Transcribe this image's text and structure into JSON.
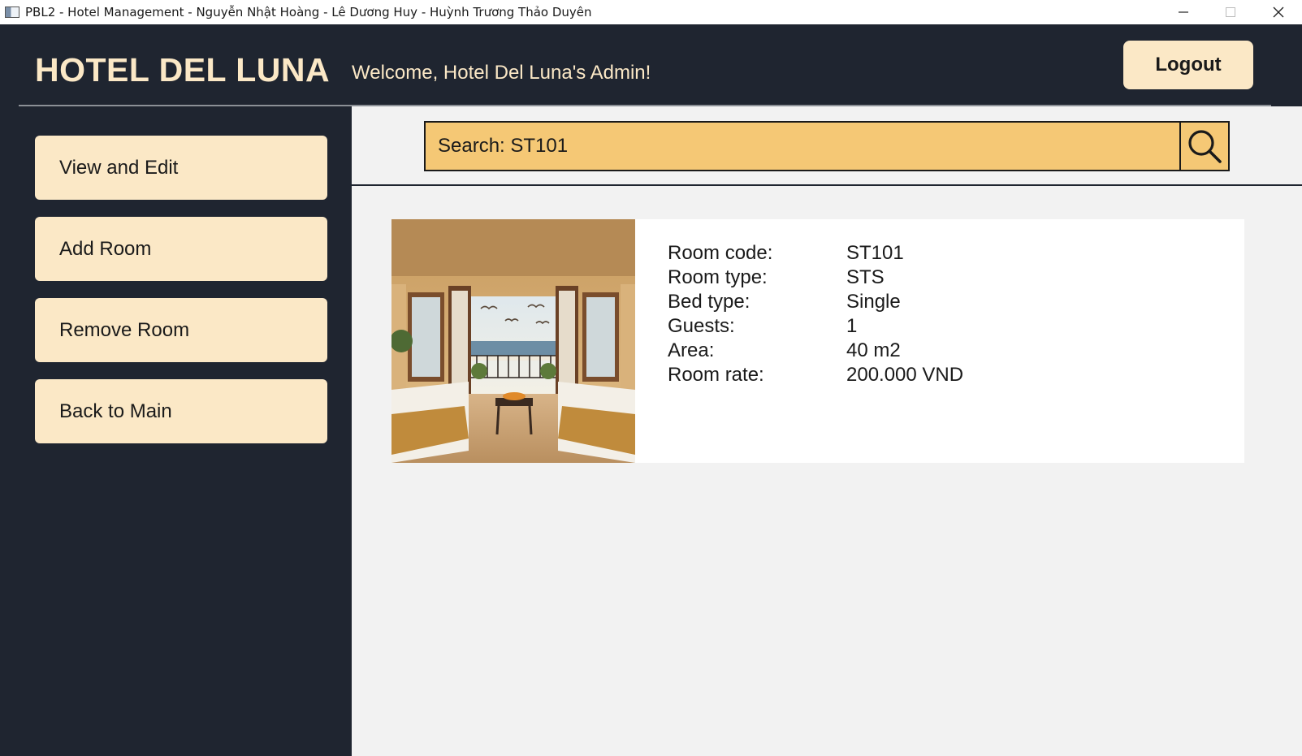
{
  "window": {
    "title": "PBL2 - Hotel Management - Nguyễn Nhật Hoàng - Lê Dương Huy - Huỳnh Trương Thảo Duyên"
  },
  "header": {
    "brand": "HOTEL DEL LUNA",
    "welcome": "Welcome, Hotel Del Luna's Admin!",
    "logout_label": "Logout"
  },
  "sidebar": {
    "items": [
      {
        "label": "View and Edit"
      },
      {
        "label": "Add Room"
      },
      {
        "label": "Remove Room"
      },
      {
        "label": "Back to Main"
      }
    ]
  },
  "search": {
    "value": "Search: ST101",
    "icon": "search-icon"
  },
  "room": {
    "image": "hotel-room-photo",
    "fields": [
      {
        "label": "Room code:",
        "value": "ST101"
      },
      {
        "label": "Room type:",
        "value": "STS"
      },
      {
        "label": "Bed type:",
        "value": "Single"
      },
      {
        "label": "Guests:",
        "value": "1"
      },
      {
        "label": "Area:",
        "value": "40 m2"
      },
      {
        "label": "Room rate:",
        "value": "200.000 VND"
      }
    ]
  },
  "colors": {
    "dark_bg": "#1f2530",
    "cream": "#fbe8c6",
    "search_bg": "#f5c875",
    "content_bg": "#f2f2f2"
  }
}
